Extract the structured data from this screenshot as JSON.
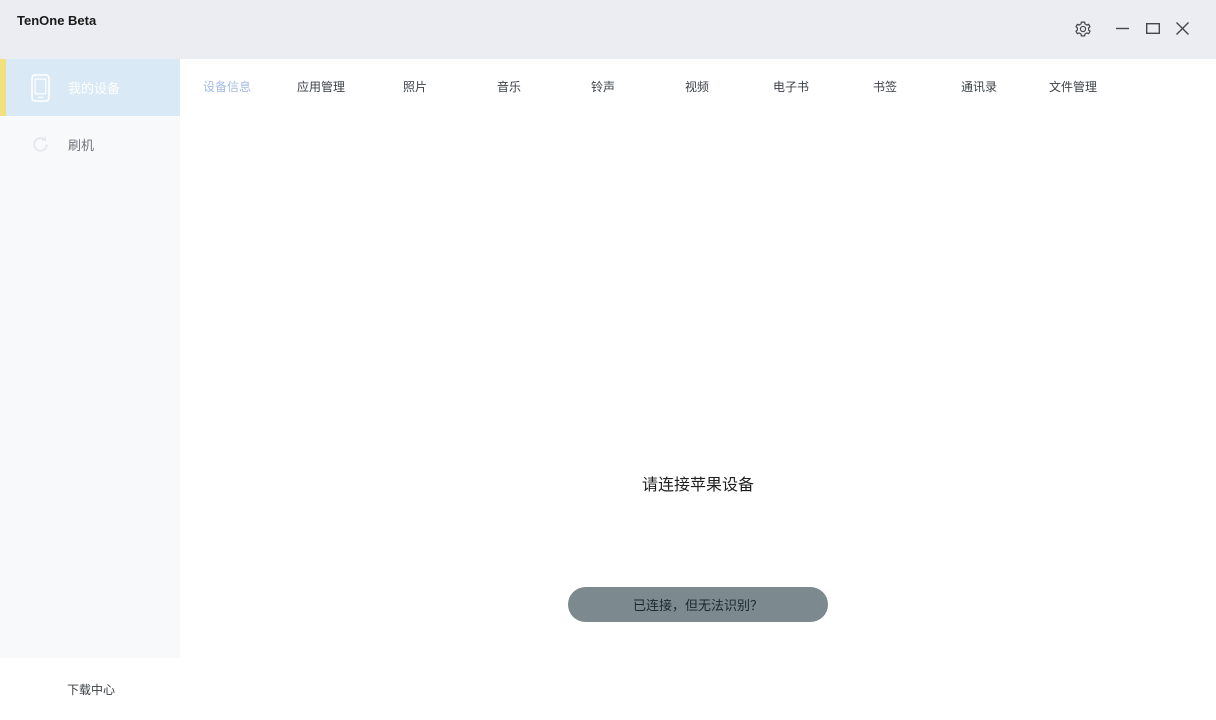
{
  "window": {
    "title": "TenOne Beta",
    "controls": {
      "settings_icon": "gear-icon",
      "minimize_icon": "minimize-icon",
      "maximize_icon": "maximize-icon",
      "close_icon": "close-icon"
    }
  },
  "sidebar": {
    "items": [
      {
        "label": "我的设备",
        "icon": "phone-icon",
        "active": true
      },
      {
        "label": "刷机",
        "icon": "refresh-icon",
        "active": false
      }
    ],
    "footer_label": "下载中心"
  },
  "tabs": [
    {
      "label": "设备信息",
      "active": true
    },
    {
      "label": "应用管理",
      "active": false
    },
    {
      "label": "照片",
      "active": false
    },
    {
      "label": "音乐",
      "active": false
    },
    {
      "label": "铃声",
      "active": false
    },
    {
      "label": "视频",
      "active": false
    },
    {
      "label": "电子书",
      "active": false
    },
    {
      "label": "书签",
      "active": false
    },
    {
      "label": "通讯录",
      "active": false
    },
    {
      "label": "文件管理",
      "active": false
    }
  ],
  "main": {
    "message": "请连接苹果设备",
    "help_button": "已连接，但无法识别？"
  },
  "colors": {
    "titlebar_bg": "#ECEDF3",
    "sidebar_bg": "#F7F9FA",
    "active_item_bg": "#D9EAF6",
    "active_item_accent": "#F0E17E",
    "active_item_text": "#FFFFFF",
    "active_tab_text": "#A3BBE3",
    "inactive_tab_text": "#3D4247",
    "help_button_bg": "#7C898E",
    "help_button_text": "#1C2A30"
  }
}
